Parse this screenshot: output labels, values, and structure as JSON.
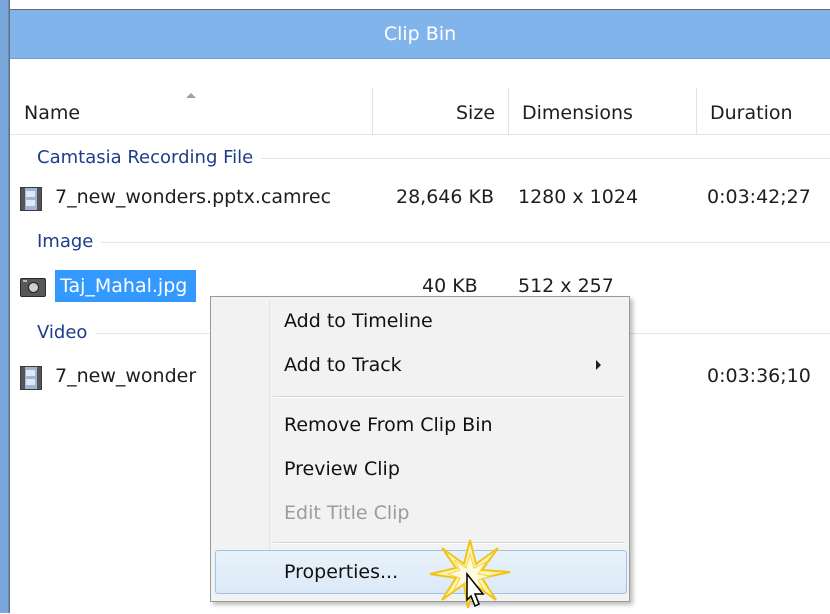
{
  "window": {
    "title": "Clip Bin"
  },
  "columns": {
    "name": "Name",
    "size": "Size",
    "dimensions": "Dimensions",
    "duration": "Duration"
  },
  "groups": [
    {
      "label": "Camtasia Recording File"
    },
    {
      "label": "Image"
    },
    {
      "label": "Video"
    }
  ],
  "rows": [
    {
      "name": "7_new_wonders.pptx.camrec",
      "size": "28,646 KB",
      "dimensions": "1280 x 1024",
      "duration": "0:03:42;27",
      "icon": "film-icon"
    },
    {
      "name": "Taj_Mahal.jpg",
      "size": "40 KB",
      "dimensions": "512 x 257",
      "duration": "",
      "icon": "camera-icon",
      "selected": true
    },
    {
      "name": "7_new_wonder",
      "size": "",
      "dimensions": "",
      "duration": "0:03:36;10",
      "icon": "film-icon"
    }
  ],
  "context_menu": {
    "items": [
      {
        "label": "Add to Timeline"
      },
      {
        "label": "Add to Track",
        "has_submenu": true
      },
      {
        "label": "Remove From Clip Bin"
      },
      {
        "label": "Preview Clip"
      },
      {
        "label": "Edit Title Clip",
        "disabled": true
      },
      {
        "label": "Properties...",
        "highlighted": true
      }
    ]
  },
  "colors": {
    "titlebar": "#82b4ec",
    "group_label": "#1f3c8a",
    "selection": "#3399ff",
    "menu_bg": "#f2f2f2",
    "sparkle": "#f4d03f"
  }
}
